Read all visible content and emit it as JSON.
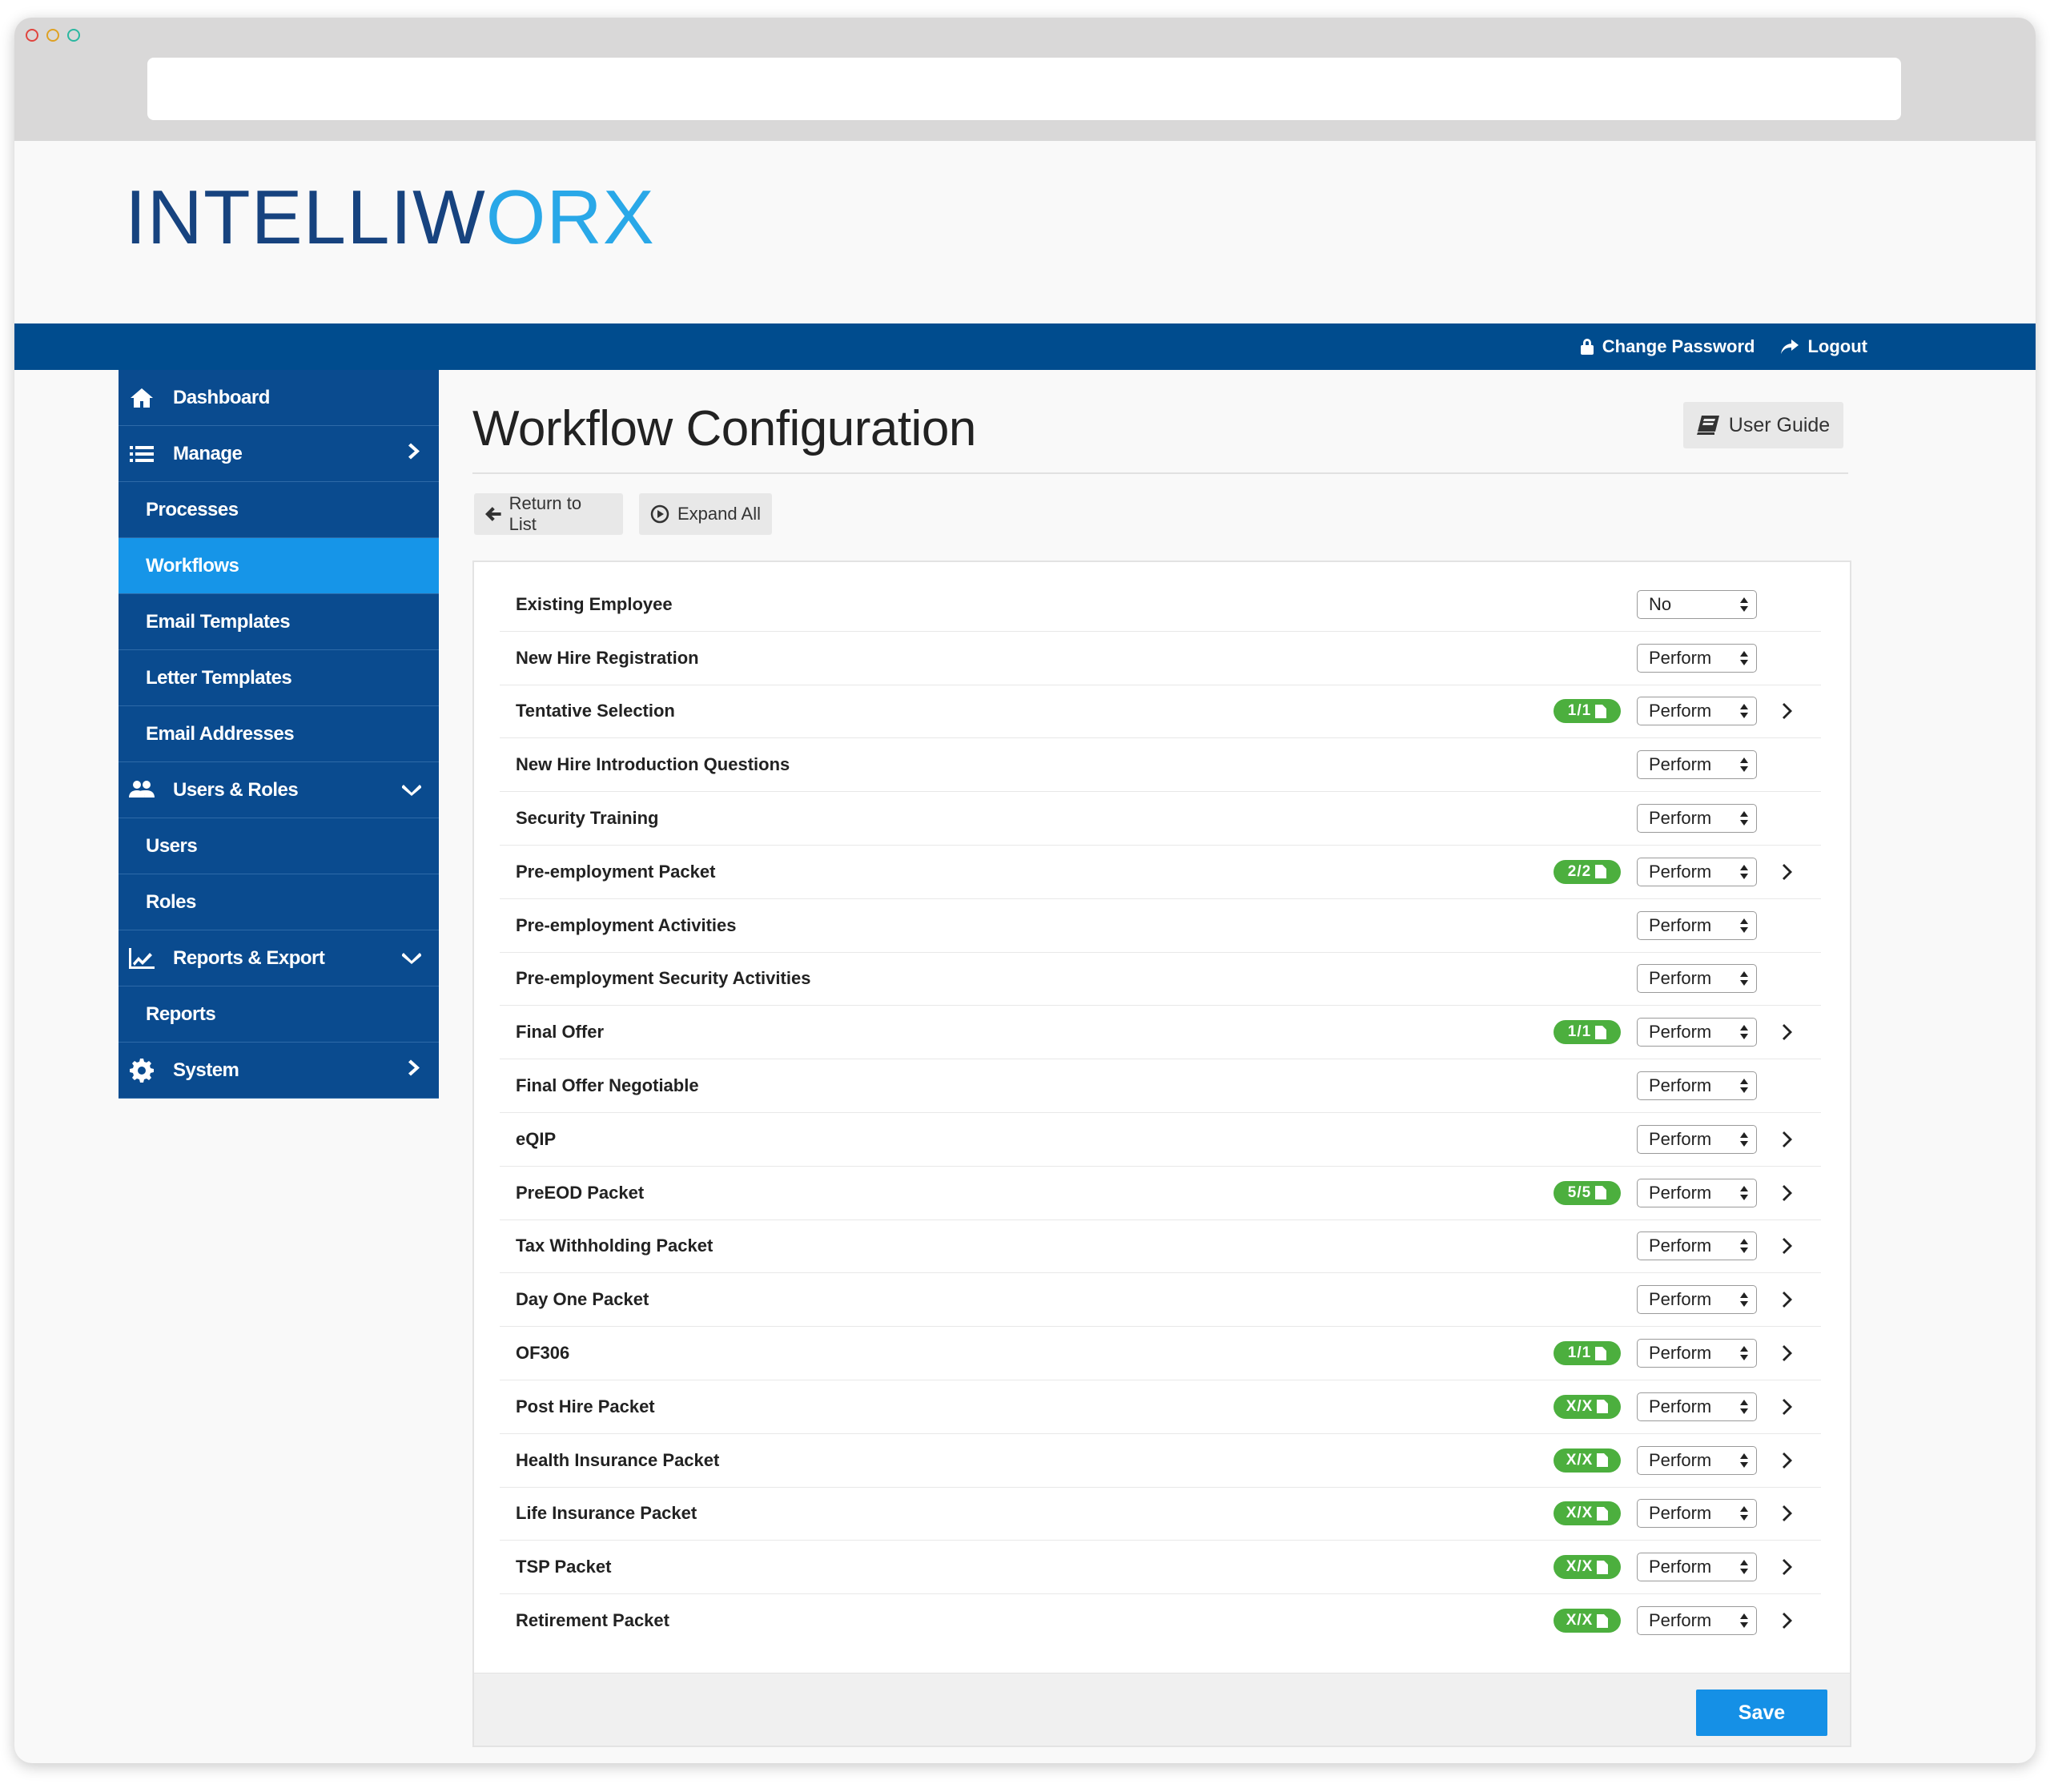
{
  "brand": {
    "logo_part1": "INTELLIW",
    "logo_part2": "O",
    "logo_part3": "RX",
    "color_dark": "#17437f",
    "color_light": "#29a8e8"
  },
  "topbar": {
    "change_password": "Change Password",
    "logout": "Logout"
  },
  "sidebar": {
    "items": [
      {
        "label": "Dashboard"
      },
      {
        "label": "Manage"
      },
      {
        "label": "Processes"
      },
      {
        "label": "Workflows"
      },
      {
        "label": "Email Templates"
      },
      {
        "label": "Letter Templates"
      },
      {
        "label": "Email Addresses"
      },
      {
        "label": "Users & Roles"
      },
      {
        "label": "Users"
      },
      {
        "label": "Roles"
      },
      {
        "label": "Reports & Export"
      },
      {
        "label": "Reports"
      },
      {
        "label": "System"
      }
    ]
  },
  "page": {
    "title": "Workflow Configuration",
    "user_guide": "User Guide",
    "return_to_list": "Return to List",
    "expand_all": "Expand All",
    "save": "Save"
  },
  "workflow": {
    "rows": [
      {
        "label": "Existing Employee",
        "value": "No"
      },
      {
        "label": "New Hire Registration",
        "value": "Perform"
      },
      {
        "label": "Tentative Selection",
        "value": "Perform",
        "badge": "1/1"
      },
      {
        "label": "New Hire Introduction Questions",
        "value": "Perform"
      },
      {
        "label": "Security Training",
        "value": "Perform"
      },
      {
        "label": "Pre-employment Packet",
        "value": "Perform",
        "badge": "2/2"
      },
      {
        "label": "Pre-employment Activities",
        "value": "Perform"
      },
      {
        "label": "Pre-employment Security Activities",
        "value": "Perform"
      },
      {
        "label": "Final Offer",
        "value": "Perform",
        "badge": "1/1"
      },
      {
        "label": "Final Offer Negotiable",
        "value": "Perform"
      },
      {
        "label": "eQIP",
        "value": "Perform"
      },
      {
        "label": "PreEOD Packet",
        "value": "Perform",
        "badge": "5/5"
      },
      {
        "label": "Tax Withholding Packet",
        "value": "Perform"
      },
      {
        "label": "Day One Packet",
        "value": "Perform"
      },
      {
        "label": "OF306",
        "value": "Perform",
        "badge": "1/1"
      },
      {
        "label": "Post Hire Packet",
        "value": "Perform",
        "badge": "X/X"
      },
      {
        "label": "Health Insurance Packet",
        "value": "Perform",
        "badge": "X/X"
      },
      {
        "label": "Life Insurance Packet",
        "value": "Perform",
        "badge": "X/X"
      },
      {
        "label": "TSP Packet",
        "value": "Perform",
        "badge": "X/X"
      },
      {
        "label": "Retirement Packet",
        "value": "Perform",
        "badge": "X/X"
      }
    ]
  },
  "colors": {
    "nav_blue": "#004c8e",
    "active_blue": "#1695e8",
    "badge_green": "#4caf3e",
    "save_blue": "#1590e6"
  }
}
